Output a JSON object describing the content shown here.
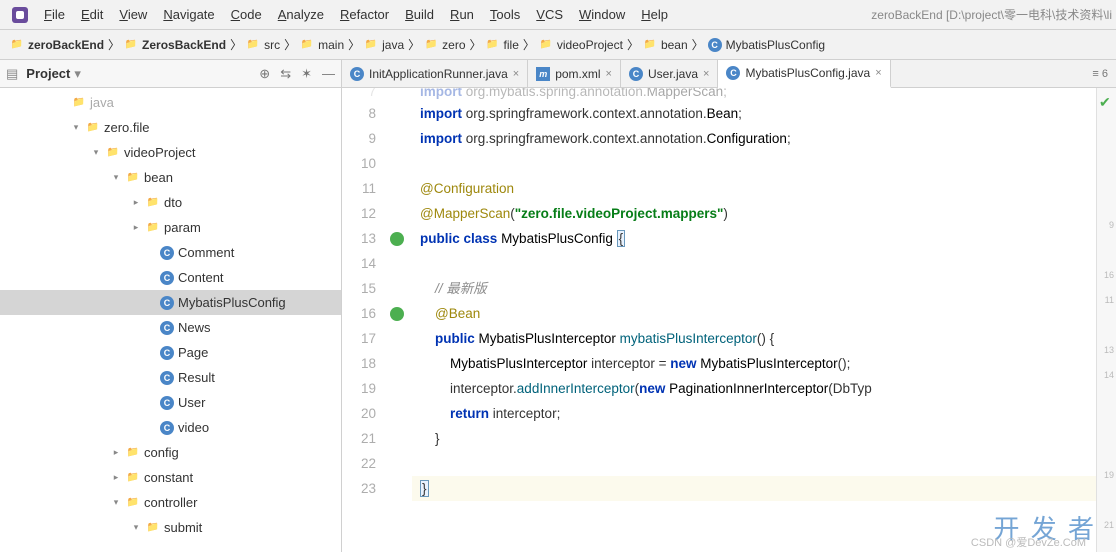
{
  "menu": {
    "items": [
      "File",
      "Edit",
      "View",
      "Navigate",
      "Code",
      "Analyze",
      "Refactor",
      "Build",
      "Run",
      "Tools",
      "VCS",
      "Window",
      "Help"
    ],
    "titlePath": "zeroBackEnd [D:\\project\\零一电科\\技术资料\\li"
  },
  "breadcrumb": [
    {
      "icon": "folder",
      "label": "zeroBackEnd",
      "bold": true
    },
    {
      "icon": "folder",
      "label": "ZerosBackEnd",
      "bold": true
    },
    {
      "icon": "folder",
      "label": "src"
    },
    {
      "icon": "folder",
      "label": "main"
    },
    {
      "icon": "folder",
      "label": "java"
    },
    {
      "icon": "folder",
      "label": "zero"
    },
    {
      "icon": "folder",
      "label": "file"
    },
    {
      "icon": "folder",
      "label": "videoProject"
    },
    {
      "icon": "folder",
      "label": "bean"
    },
    {
      "icon": "class",
      "label": "MybatisPlusConfig"
    }
  ],
  "sidebar": {
    "title": "Project",
    "tree": [
      {
        "indent": 56,
        "chev": "",
        "icon": "folder",
        "label": "java",
        "faded": true
      },
      {
        "indent": 70,
        "chev": "▾",
        "icon": "folder",
        "label": "zero.file"
      },
      {
        "indent": 90,
        "chev": "▾",
        "icon": "folder",
        "label": "videoProject"
      },
      {
        "indent": 110,
        "chev": "▾",
        "icon": "folder",
        "label": "bean"
      },
      {
        "indent": 130,
        "chev": "▸",
        "icon": "folder",
        "label": "dto"
      },
      {
        "indent": 130,
        "chev": "▸",
        "icon": "folder",
        "label": "param"
      },
      {
        "indent": 144,
        "chev": "",
        "icon": "class",
        "label": "Comment"
      },
      {
        "indent": 144,
        "chev": "",
        "icon": "class",
        "label": "Content"
      },
      {
        "indent": 144,
        "chev": "",
        "icon": "class",
        "label": "MybatisPlusConfig",
        "selected": true
      },
      {
        "indent": 144,
        "chev": "",
        "icon": "class",
        "label": "News"
      },
      {
        "indent": 144,
        "chev": "",
        "icon": "class",
        "label": "Page"
      },
      {
        "indent": 144,
        "chev": "",
        "icon": "class",
        "label": "Result"
      },
      {
        "indent": 144,
        "chev": "",
        "icon": "class",
        "label": "User"
      },
      {
        "indent": 144,
        "chev": "",
        "icon": "class",
        "label": "video"
      },
      {
        "indent": 110,
        "chev": "▸",
        "icon": "folder",
        "label": "config"
      },
      {
        "indent": 110,
        "chev": "▸",
        "icon": "folder",
        "label": "constant"
      },
      {
        "indent": 110,
        "chev": "▾",
        "icon": "folder",
        "label": "controller"
      },
      {
        "indent": 130,
        "chev": "▾",
        "icon": "folder",
        "label": "submit"
      }
    ]
  },
  "tabs": [
    {
      "icon": "class",
      "label": "InitApplicationRunner.java",
      "active": false
    },
    {
      "icon": "m",
      "label": "pom.xml",
      "active": false
    },
    {
      "icon": "class",
      "label": "User.java",
      "active": false
    },
    {
      "icon": "class",
      "label": "MybatisPlusConfig.java",
      "active": true
    }
  ],
  "tabExtra": "≡ 6",
  "code": {
    "start": 8,
    "lines": [
      {
        "n": 7,
        "mark": "",
        "html": "<span class='kw'>import</span> org.mybatis.spring.annotation.<span class='cls'>MapperScan</span>;",
        "faded": true
      },
      {
        "n": 8,
        "mark": "",
        "html": "<span class='kw'>import</span> org.springframework.context.annotation.<span class='cls'>Bean</span>;"
      },
      {
        "n": 9,
        "mark": "",
        "html": "<span class='kw'>import</span> org.springframework.context.annotation.<span class='cls'>Configuration</span>;"
      },
      {
        "n": 10,
        "mark": "",
        "html": ""
      },
      {
        "n": 11,
        "mark": "",
        "html": "<span class='ann'>@Configuration</span>"
      },
      {
        "n": 12,
        "mark": "",
        "html": "<span class='ann'>@MapperScan</span>(<span class='str'>\"zero.file.videoProject.mappers\"</span>)"
      },
      {
        "n": 13,
        "mark": "green",
        "html": "<span class='kw'>public class</span> <span class='cls'>MybatisPlusConfig</span> <span class='hl-brace'>{</span>"
      },
      {
        "n": 14,
        "mark": "",
        "html": ""
      },
      {
        "n": 15,
        "mark": "",
        "html": "    <span class='cmt'>// 最新版</span>"
      },
      {
        "n": 16,
        "mark": "green",
        "html": "    <span class='ann'>@Bean</span>"
      },
      {
        "n": 17,
        "mark": "",
        "html": "    <span class='kw'>public</span> <span class='cls'>MybatisPlusInterceptor</span> <span class='meth'>mybatisPlusInterceptor</span>() {"
      },
      {
        "n": 18,
        "mark": "",
        "html": "        <span class='cls'>MybatisPlusInterceptor</span> interceptor = <span class='kw'>new</span> <span class='cls'>MybatisPlusInterceptor</span>();"
      },
      {
        "n": 19,
        "mark": "",
        "html": "        interceptor.<span class='meth'>addInnerInterceptor</span>(<span class='kw'>new</span> <span class='cls'>PaginationInnerInterceptor</span>(DbTyp"
      },
      {
        "n": 20,
        "mark": "",
        "html": "        <span class='kw'>return</span> interceptor;"
      },
      {
        "n": 21,
        "mark": "",
        "html": "    }"
      },
      {
        "n": 22,
        "mark": "",
        "html": ""
      },
      {
        "n": 23,
        "mark": "",
        "html": "<span class='hl-brace'>}</span>",
        "hl": true
      }
    ],
    "mini": [
      "",
      "",
      "",
      "",
      "",
      "9",
      "",
      "16",
      "11",
      "",
      "13",
      "14",
      "",
      "",
      "",
      "19",
      "",
      "21"
    ]
  },
  "watermark": "开 发 者",
  "watermark2": "CSDN @爱DevZe.CoM"
}
